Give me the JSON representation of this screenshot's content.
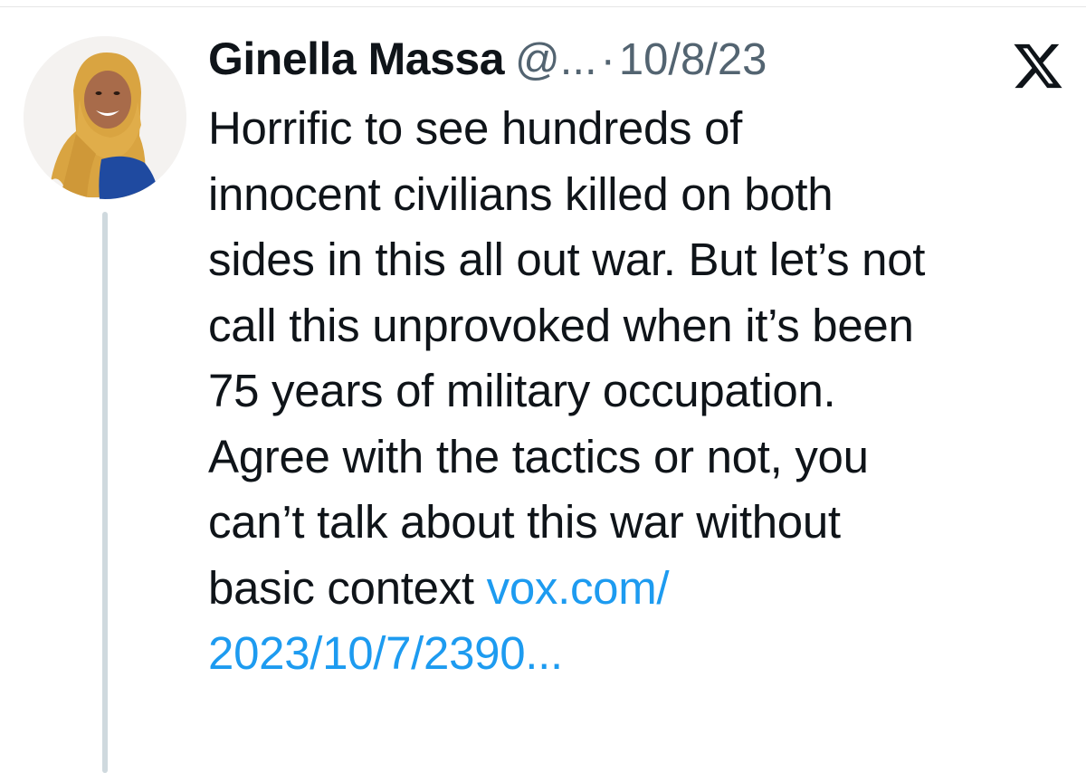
{
  "tweet": {
    "author": {
      "display_name": "Ginella Massa",
      "handle": "@...",
      "avatar_icon": "profile-photo"
    },
    "separator": "·",
    "date": "10/8/23",
    "platform_icon": "x-logo-icon",
    "text_lines": [
      "Horrific to see hundreds of",
      "innocent civilians killed on both",
      "sides in this all out war. But let’s not",
      "call this unprovoked when it’s been",
      "75 years of military occupation.",
      "Agree with the tactics or not, you",
      "can’t talk about this war without",
      "basic context "
    ],
    "link_line1": "vox.com/",
    "link_line2": "2023/10/7/2390..."
  },
  "colors": {
    "text": "#0f1419",
    "secondary": "#536471",
    "link": "#1d9bf0",
    "thread_line": "#cfd9de"
  }
}
